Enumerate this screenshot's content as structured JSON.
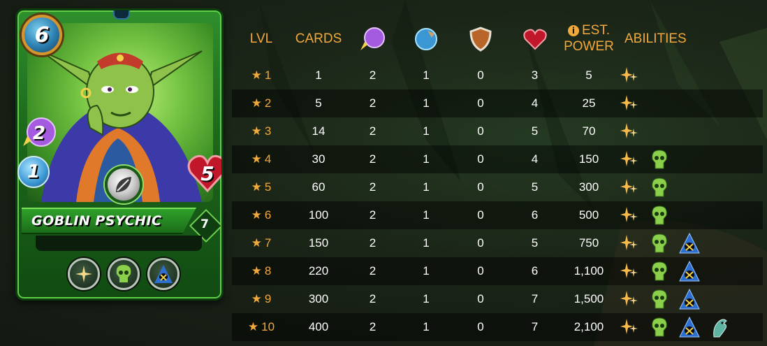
{
  "card": {
    "name": "GOBLIN PSYCHIC",
    "mana": "6",
    "magic": "2",
    "speed": "1",
    "health": "5",
    "level": "7",
    "element": "leaf-icon",
    "abilities": [
      "sparkle-icon",
      "skull-icon",
      "hooded-figure-icon"
    ],
    "colors": {
      "accent": "#f2a93b",
      "card_green": "#2f8f2d"
    }
  },
  "table": {
    "headers": {
      "lvl": "LVL",
      "cards": "CARDS",
      "magic": "magic-icon",
      "speed": "speed-icon",
      "armor": "shield-icon",
      "health": "heart-icon",
      "power_info": "i",
      "power_line1": "EST.",
      "power_line2": "POWER",
      "abilities": "ABILITIES"
    },
    "star": "★",
    "rows": [
      {
        "lvl": "1",
        "cards": "1",
        "magic": "2",
        "speed": "1",
        "armor": "0",
        "health": "3",
        "power": "5",
        "abilities": [
          "sparkle"
        ]
      },
      {
        "lvl": "2",
        "cards": "5",
        "magic": "2",
        "speed": "1",
        "armor": "0",
        "health": "4",
        "power": "25",
        "abilities": [
          "sparkle"
        ]
      },
      {
        "lvl": "3",
        "cards": "14",
        "magic": "2",
        "speed": "1",
        "armor": "0",
        "health": "5",
        "power": "70",
        "abilities": [
          "sparkle"
        ]
      },
      {
        "lvl": "4",
        "cards": "30",
        "magic": "2",
        "speed": "1",
        "armor": "0",
        "health": "4",
        "power": "150",
        "abilities": [
          "sparkle",
          "skull"
        ]
      },
      {
        "lvl": "5",
        "cards": "60",
        "magic": "2",
        "speed": "1",
        "armor": "0",
        "health": "5",
        "power": "300",
        "abilities": [
          "sparkle",
          "skull"
        ]
      },
      {
        "lvl": "6",
        "cards": "100",
        "magic": "2",
        "speed": "1",
        "armor": "0",
        "health": "6",
        "power": "500",
        "abilities": [
          "sparkle",
          "skull"
        ]
      },
      {
        "lvl": "7",
        "cards": "150",
        "magic": "2",
        "speed": "1",
        "armor": "0",
        "health": "5",
        "power": "750",
        "abilities": [
          "sparkle",
          "skull",
          "hood"
        ]
      },
      {
        "lvl": "8",
        "cards": "220",
        "magic": "2",
        "speed": "1",
        "armor": "0",
        "health": "6",
        "power": "1,100",
        "abilities": [
          "sparkle",
          "skull",
          "hood"
        ]
      },
      {
        "lvl": "9",
        "cards": "300",
        "magic": "2",
        "speed": "1",
        "armor": "0",
        "health": "7",
        "power": "1,500",
        "abilities": [
          "sparkle",
          "skull",
          "hood"
        ]
      },
      {
        "lvl": "10",
        "cards": "400",
        "magic": "2",
        "speed": "1",
        "armor": "0",
        "health": "7",
        "power": "2,100",
        "abilities": [
          "sparkle",
          "skull",
          "hood",
          "dragon"
        ]
      }
    ]
  }
}
